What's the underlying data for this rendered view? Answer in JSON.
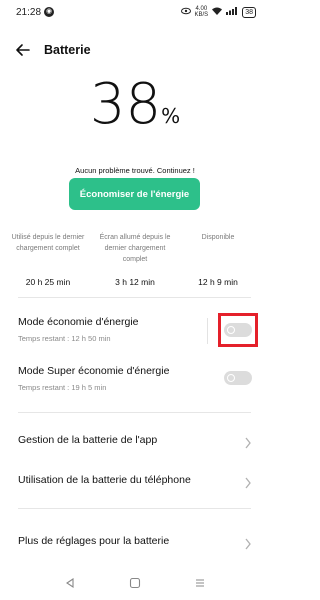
{
  "status_bar": {
    "time": "21:28",
    "net_speed_top": "4.00",
    "net_speed_bottom": "KB/S",
    "battery": "38"
  },
  "header": {
    "title": "Batterie"
  },
  "battery": {
    "percent": "38",
    "percent_sign": "%"
  },
  "status_message": "Aucun problème trouvé. Continuez !",
  "save_button_label": "Économiser de l'énergie",
  "stats": [
    {
      "label": "Utilisé depuis le dernier chargement complet",
      "value": "20 h 25 min"
    },
    {
      "label": "Écran allumé depuis le dernier chargement complet",
      "value": "3 h 12 min"
    },
    {
      "label": "Disponible",
      "value": "12 h 9 min"
    }
  ],
  "power_saving": {
    "title": "Mode économie d'énergie",
    "subtitle": "Temps restant : 12 h 50 min",
    "enabled": false
  },
  "super_power_saving": {
    "title": "Mode Super économie d'énergie",
    "subtitle": "Temps restant : 19 h 5 min",
    "enabled": false
  },
  "menu": [
    {
      "label": "Gestion de la batterie de l'app"
    },
    {
      "label": "Utilisation de la batterie du téléphone"
    },
    {
      "label": "Plus de réglages pour la batterie"
    }
  ],
  "colors": {
    "accent_green": "#2dc08a",
    "highlight_red": "#e4202a",
    "toggle_off": "#dcdcdc"
  },
  "icons": [
    "back-arrow-icon",
    "chevron-right-icon",
    "nav-back-icon",
    "nav-home-icon",
    "nav-recents-icon"
  ]
}
